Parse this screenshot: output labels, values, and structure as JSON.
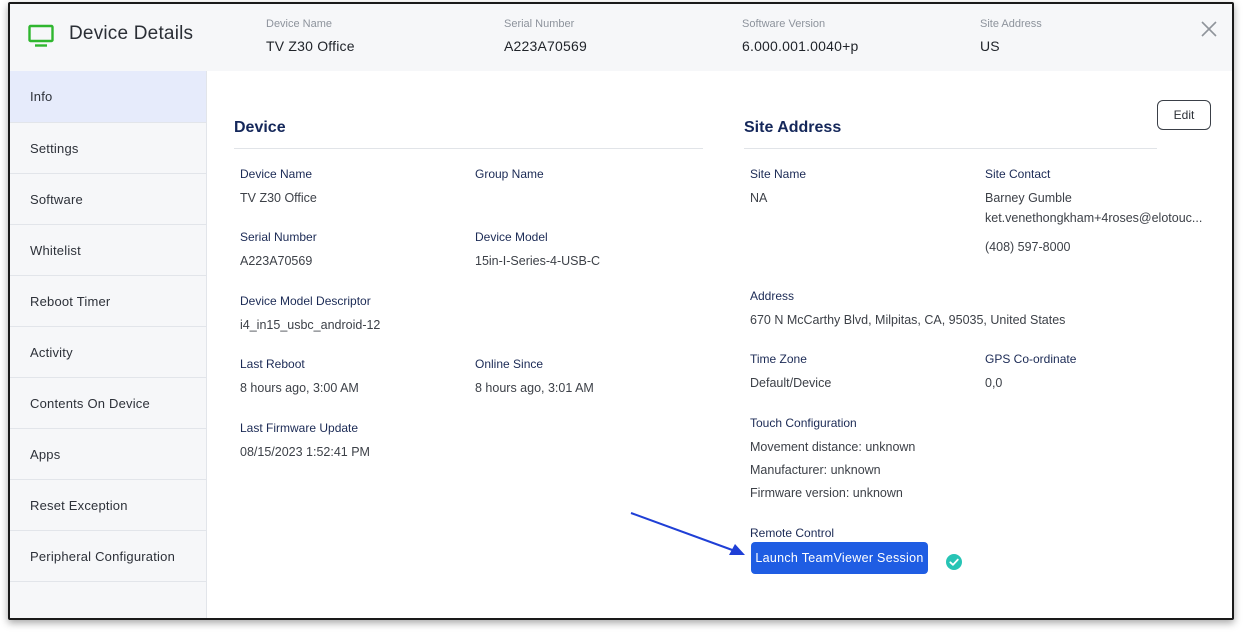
{
  "header": {
    "title": "Device Details",
    "icon": "monitor-icon",
    "accent": "#2fb62f",
    "fields": [
      {
        "label": "Device Name",
        "value": "TV Z30 Office"
      },
      {
        "label": "Serial Number",
        "value": "A223A70569"
      },
      {
        "label": "Software Version",
        "value": "6.000.001.0040+p"
      },
      {
        "label": "Site Address",
        "value": "US"
      }
    ]
  },
  "sidebar": {
    "items": [
      {
        "label": "Info",
        "active": true
      },
      {
        "label": "Settings"
      },
      {
        "label": "Software"
      },
      {
        "label": "Whitelist"
      },
      {
        "label": "Reboot Timer"
      },
      {
        "label": "Activity"
      },
      {
        "label": "Contents On Device"
      },
      {
        "label": "Apps"
      },
      {
        "label": "Reset Exception"
      },
      {
        "label": "Peripheral Configuration"
      }
    ]
  },
  "device": {
    "title": "Device",
    "device_name": {
      "label": "Device Name",
      "value": "TV Z30 Office"
    },
    "group_name": {
      "label": "Group Name",
      "value": ""
    },
    "serial_number": {
      "label": "Serial Number",
      "value": "A223A70569"
    },
    "device_model": {
      "label": "Device Model",
      "value": "15in-I-Series-4-USB-C"
    },
    "model_descriptor": {
      "label": "Device Model Descriptor",
      "value": "i4_in15_usbc_android-12"
    },
    "last_reboot": {
      "label": "Last Reboot",
      "value": "8 hours ago, 3:00 AM"
    },
    "online_since": {
      "label": "Online Since",
      "value": "8 hours ago, 3:01 AM"
    },
    "last_firmware_update": {
      "label": "Last Firmware Update",
      "value": "08/15/2023 1:52:41 PM"
    }
  },
  "site": {
    "title": "Site Address",
    "edit_label": "Edit",
    "site_name": {
      "label": "Site Name",
      "value": "NA"
    },
    "site_contact": {
      "label": "Site Contact",
      "name": "Barney Gumble",
      "email": "ket.venethongkham+4roses@elotouc...",
      "phone": "(408) 597-8000"
    },
    "address": {
      "label": "Address",
      "value": "670 N McCarthy Blvd, Milpitas, CA, 95035, United States"
    },
    "time_zone": {
      "label": "Time Zone",
      "value": "Default/Device"
    },
    "gps": {
      "label": "GPS Co-ordinate",
      "value": "0,0"
    },
    "touch_config": {
      "label": "Touch Configuration",
      "movement": "Movement distance: unknown",
      "manufacturer": "Manufacturer: unknown",
      "firmware": "Firmware version: unknown"
    },
    "remote_control": {
      "label": "Remote Control",
      "button_label": "Launch TeamViewer Session",
      "button_color": "#1f5de3",
      "status_icon": "check-circle-icon",
      "status_color": "#27c4b5"
    }
  }
}
